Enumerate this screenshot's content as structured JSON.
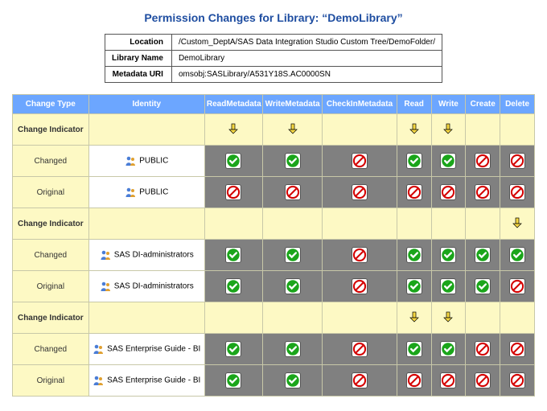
{
  "title": "Permission Changes for Library: “DemoLibrary”",
  "meta": {
    "location_label": "Location",
    "location": "/Custom_DeptA/SAS Data Integration Studio Custom Tree/DemoFolder/",
    "libname_label": "Library Name",
    "libname": "DemoLibrary",
    "uri_label": "Metadata URI",
    "uri": "omsobj:SASLibrary/A531Y18S.AC0000SN"
  },
  "headers": {
    "change_type": "Change Type",
    "identity": "Identity",
    "p0": "ReadMetadata",
    "p1": "WriteMetadata",
    "p2": "CheckInMetadata",
    "p3": "Read",
    "p4": "Write",
    "p5": "Create",
    "p6": "Delete"
  },
  "row_labels": {
    "indicator": "Change Indicator",
    "changed": "Changed",
    "original": "Original"
  },
  "groups": [
    {
      "identity": "PUBLIC",
      "indicator": [
        "arrow",
        "arrow",
        "",
        "arrow",
        "arrow",
        "",
        ""
      ],
      "changed": [
        "allow",
        "allow",
        "deny",
        "allow",
        "allow",
        "deny",
        "deny"
      ],
      "original": [
        "deny",
        "deny",
        "deny",
        "deny",
        "deny",
        "deny",
        "deny"
      ]
    },
    {
      "identity": "SAS DI-administrators",
      "indicator": [
        "",
        "",
        "",
        "",
        "",
        "",
        "arrow"
      ],
      "changed": [
        "allow",
        "allow",
        "deny",
        "allow",
        "allow",
        "allow",
        "allow"
      ],
      "original": [
        "allow",
        "allow",
        "deny",
        "allow",
        "allow",
        "allow",
        "deny"
      ]
    },
    {
      "identity": "SAS Enterprise Guide - BI",
      "indicator": [
        "",
        "",
        "",
        "arrow",
        "arrow",
        "",
        ""
      ],
      "changed": [
        "allow",
        "allow",
        "deny",
        "allow",
        "allow",
        "deny",
        "deny"
      ],
      "original": [
        "allow",
        "allow",
        "deny",
        "deny",
        "deny",
        "deny",
        "deny"
      ]
    }
  ]
}
